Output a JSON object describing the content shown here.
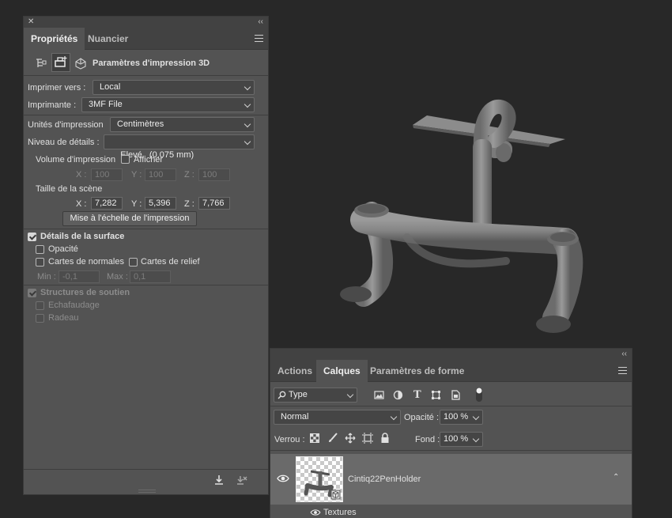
{
  "properties_panel": {
    "tabs": [
      {
        "label": "Propriétés",
        "active": true
      },
      {
        "label": "Nuancier",
        "active": false
      }
    ],
    "section_title": "Paramètres d'impression 3D",
    "print_to": {
      "label": "Imprimer vers :",
      "value": "Local"
    },
    "printer": {
      "label": "Imprimante :",
      "value": "3MF File"
    },
    "print_units": {
      "label": "Unités d'impression",
      "value": "Centimètres"
    },
    "detail_level": {
      "label": "Niveau de détails :",
      "value": "Elevé   (0,075 mm)"
    },
    "print_volume": {
      "label": "Volume d'impression",
      "show_label": "Afficher",
      "show_checked": false,
      "x_label": "X :",
      "x_value": "100",
      "y_label": "Y :",
      "y_value": "100",
      "z_label": "Z :",
      "z_value": "100"
    },
    "scene_size": {
      "label": "Taille de la scène",
      "x_label": "X :",
      "x_value": "7,282",
      "y_label": "Y :",
      "y_value": "5,396",
      "z_label": "Z :",
      "z_value": "7,766"
    },
    "scale_button": "Mise à l'échelle de l'impression",
    "surface_details": {
      "label": "Détails de la surface",
      "checked": true,
      "opacity": {
        "label": "Opacité",
        "checked": false
      },
      "normal_maps": {
        "label": "Cartes de normales",
        "checked": false
      },
      "relief_maps": {
        "label": "Cartes de relief",
        "checked": false
      },
      "min_label": "Min :",
      "min_value": "-0,1",
      "max_label": "Max :",
      "max_value": "0,1"
    },
    "support_structures": {
      "label": "Structures de soutien",
      "checked": true,
      "scaffolding": {
        "label": "Echafaudage",
        "checked": false
      },
      "raft": {
        "label": "Radeau",
        "checked": false
      }
    }
  },
  "layers_panel": {
    "tabs": [
      {
        "label": "Actions",
        "active": false
      },
      {
        "label": "Calques",
        "active": true
      },
      {
        "label": "Paramètres de forme",
        "active": false
      }
    ],
    "filter_kind": "Type",
    "blend_mode": "Normal",
    "opacity_label": "Opacité :",
    "opacity_value": "100 %",
    "lock_label": "Verrou :",
    "fill_label": "Fond :",
    "fill_value": "100 %",
    "layer": {
      "name": "Cintiq22PenHolder",
      "visible": true
    },
    "sublayer": {
      "name": "Textures"
    }
  },
  "colors": {
    "workspace": "#282828",
    "panel": "#535353",
    "panel_header": "#424242",
    "model": "#8a8a8a"
  },
  "icons": [
    "close-icon",
    "collapse-icon",
    "panel-menu-icon",
    "scene-icon",
    "print-settings-icon",
    "mesh-icon",
    "search-icon",
    "image-filter-icon",
    "adjustment-filter-icon",
    "text-filter-icon",
    "shape-filter-icon",
    "smart-object-filter-icon",
    "filter-toggle-icon",
    "lock-transparency-icon",
    "lock-brush-icon",
    "lock-move-icon",
    "lock-artboard-icon",
    "lock-all-icon",
    "eye-icon",
    "print-icon",
    "cancel-print-icon"
  ]
}
